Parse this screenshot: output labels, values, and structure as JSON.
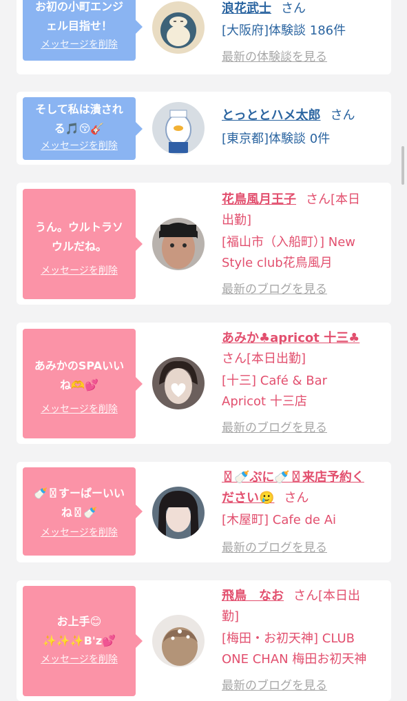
{
  "colors": {
    "blue_bubble": "#8ab4f2",
    "pink_bubble": "#fb93a7",
    "blue_text": "#2a64a0",
    "pink_text": "#e24f6e",
    "grey_link": "#a7a7a7",
    "background": "#f3f3f4"
  },
  "cards": [
    {
      "bubble_line1": "お初の小町エンジ",
      "bubble_line2": "ェル目指せ！",
      "delete_label": "メッセージを削除",
      "name": "浪花武士",
      "san": "さん",
      "location": "[大阪府]体験談 186件",
      "latest": "最新の体験談を見る",
      "avatar": "snorlax-avatar"
    },
    {
      "bubble_line1": "そして私は潰され",
      "bubble_line2": "る🎵😚🎸",
      "delete_label": "メッセージを削除",
      "name": "とっととハメ太郎",
      "san": "さん",
      "location": "[東京都]体験談 0件",
      "avatar": "penguin-avatar"
    },
    {
      "bubble_line1": "うん。ウルトラソ",
      "bubble_line2": "ウルだね。",
      "delete_label": "メッセージを削除",
      "name": "花鳥風月王子",
      "san": "さん[本日",
      "san2": "出勤]",
      "location_line1": "[福山市（入船町）] New",
      "location_line2": "Style club花鳥風月",
      "latest": "最新のブログを見る",
      "avatar": "man-face-avatar"
    },
    {
      "bubble_line1": "あみかのSPAいい",
      "bubble_line2": "ね🫶💕",
      "delete_label": "メッセージを削除",
      "name": "あみか♣apricot 十三♣",
      "san": "さん[本日出勤]",
      "location_line1": "[十三] Café & Bar",
      "location_line2": "Apricot 十三店",
      "latest": "最新のブログを見る",
      "avatar": "girl-heart-avatar"
    },
    {
      "bubble_line1": "🍼〿すーぱーいい",
      "bubble_line2": "ね〿🍼",
      "delete_label": "メッセージを削除",
      "name_line1": "〿🍼ぷに🍼〿来店予約く",
      "name_line2": "ださい🥲",
      "san": "さん",
      "location": "[木屋町] Cafe de Ai",
      "latest": "最新のブログを見る",
      "avatar": "girl-dark-avatar"
    },
    {
      "bubble_line1": "お上手😊",
      "bubble_line2": "✨✨✨B'z💕",
      "delete_label": "メッセージを削除",
      "name": "飛鳥　なお",
      "san": "さん[本日出",
      "san2": "勤]",
      "location_line1": "[梅田・お初天神] CLUB",
      "location_line2": "ONE CHAN 梅田お初天神",
      "latest": "最新のブログを見る",
      "avatar": "hair-avatar"
    }
  ]
}
